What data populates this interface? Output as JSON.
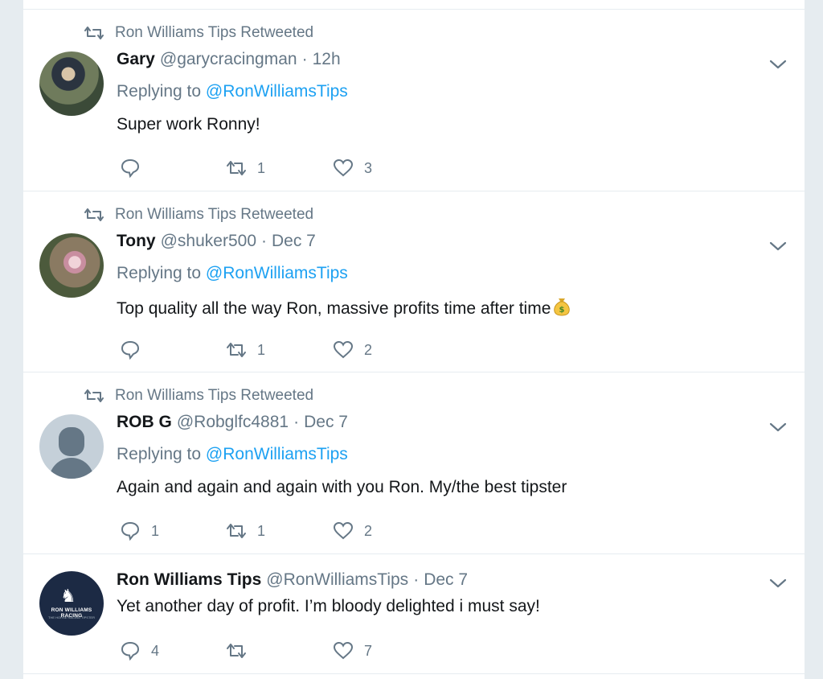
{
  "colors": {
    "link": "#1da1f2",
    "muted": "#657786",
    "text": "#14171a",
    "divider": "#e6ecf0"
  },
  "tweets": [
    {
      "retweet_label": "Ron Williams Tips Retweeted",
      "name": "Gary",
      "handle": "@garycracingman",
      "dot": "·",
      "time": "12h",
      "replying_prefix": "Replying to",
      "replying_to": "@RonWilliamsTips",
      "text": "Super work Ronny!",
      "reply_count": "",
      "retweet_count": "1",
      "like_count": "3",
      "avatar": "gary-photo"
    },
    {
      "retweet_label": "Ron Williams Tips Retweeted",
      "name": "Tony",
      "handle": "@shuker500",
      "dot": "·",
      "time": "Dec 7",
      "replying_prefix": "Replying to",
      "replying_to": "@RonWilliamsTips",
      "text": "Top quality all the way Ron, massive profits time after time",
      "emoji": "money-bag-icon",
      "reply_count": "",
      "retweet_count": "1",
      "like_count": "2",
      "avatar": "tony-photo"
    },
    {
      "retweet_label": "Ron Williams Tips Retweeted",
      "name": "ROB G",
      "handle": "@Robglfc4881",
      "dot": "·",
      "time": "Dec 7",
      "replying_prefix": "Replying to",
      "replying_to": "@RonWilliamsTips",
      "text": "Again and again and again with you Ron. My/the best tipster",
      "reply_count": "1",
      "retweet_count": "1",
      "like_count": "2",
      "avatar": "default-profile-icon"
    },
    {
      "name": "Ron Williams Tips",
      "handle": "@RonWilliamsTips",
      "dot": "·",
      "time": "Dec 7",
      "text": "Yet another day of profit. I’m bloody delighted i must say!",
      "reply_count": "4",
      "retweet_count": "",
      "like_count": "7",
      "avatar": "ron-williams-racing-logo",
      "logo_text": "RON WILLIAMS RACING",
      "logo_subtext": "THE HORSE RACING TIPSTER"
    }
  ]
}
